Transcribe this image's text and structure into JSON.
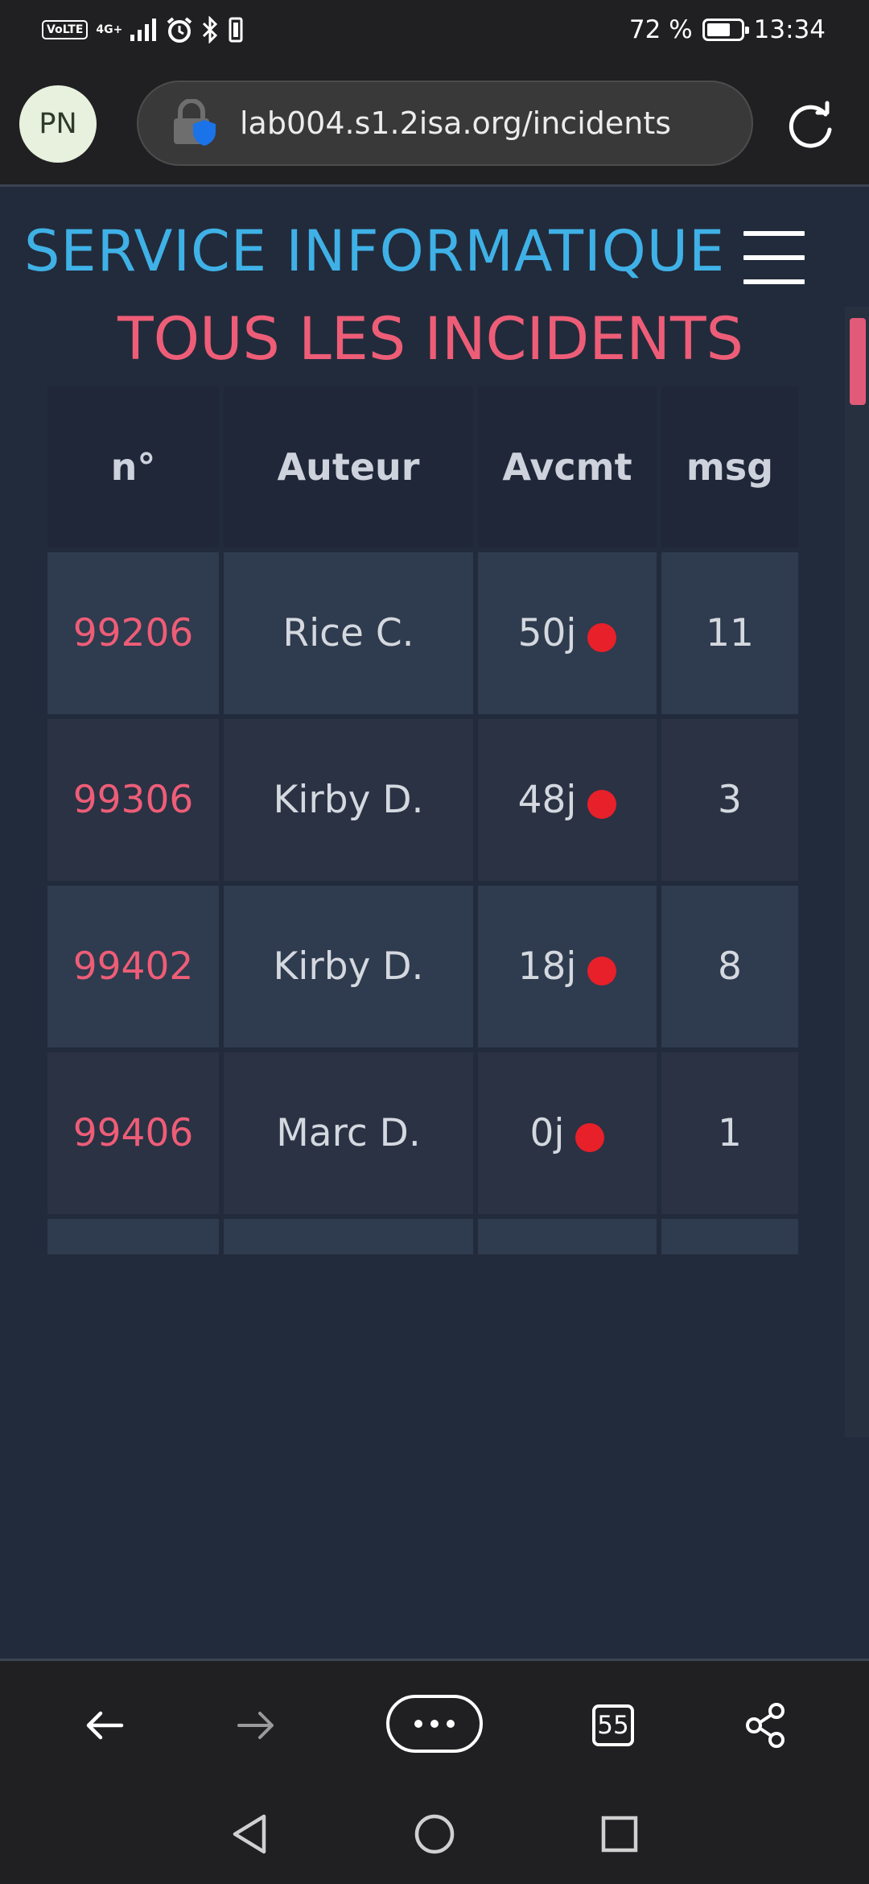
{
  "status_bar": {
    "volte_label": "VoLTE",
    "network_label": "4G+",
    "battery_percent": "72 %",
    "battery_level": 0.72,
    "time": "13:34"
  },
  "browser": {
    "avatar_initials": "PN",
    "url": "lab004.s1.2isa.org/incidents",
    "icons": [
      "lock-icon",
      "shield-icon",
      "reload-icon"
    ]
  },
  "page": {
    "site_title": "SERVICE INFORMATIQUE",
    "heading": "TOUS LES INCIDENTS",
    "colors": {
      "title": "#3fb1e7",
      "heading": "#ee5d77",
      "status_dot": "#e7202a",
      "background": "#222b3b"
    }
  },
  "table": {
    "headers": [
      "n°",
      "Auteur",
      "Avcmt",
      "msg"
    ],
    "rows": [
      {
        "number": "99206",
        "author": "Rice C.",
        "progress": "50j",
        "messages": "11",
        "status": "red"
      },
      {
        "number": "99306",
        "author": "Kirby D.",
        "progress": "48j",
        "messages": "3",
        "status": "red"
      },
      {
        "number": "99402",
        "author": "Kirby D.",
        "progress": "18j",
        "messages": "8",
        "status": "red"
      },
      {
        "number": "99406",
        "author": "Marc D.",
        "progress": "0j",
        "messages": "1",
        "status": "red"
      }
    ]
  },
  "toolbar": {
    "tab_count": "55",
    "icons": [
      "back-arrow-icon",
      "forward-arrow-icon",
      "more-menu-icon",
      "tabs-icon",
      "share-icon"
    ]
  },
  "navbar": {
    "icons": [
      "nav-back-icon",
      "nav-home-icon",
      "nav-recents-icon"
    ]
  }
}
